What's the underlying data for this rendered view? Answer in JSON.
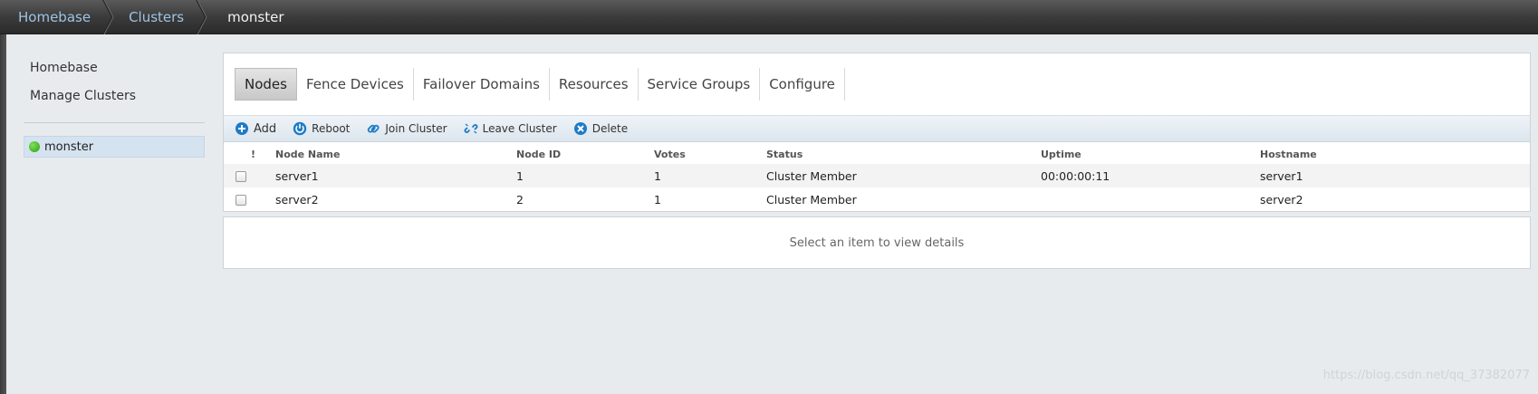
{
  "breadcrumb": {
    "items": [
      "Homebase",
      "Clusters"
    ],
    "current": "monster"
  },
  "sidebar": {
    "links": [
      "Homebase",
      "Manage Clusters"
    ],
    "clusters": [
      {
        "name": "monster",
        "status": "running",
        "status_color": "#3aad17"
      }
    ]
  },
  "tabs": [
    {
      "label": "Nodes",
      "active": true
    },
    {
      "label": "Fence Devices"
    },
    {
      "label": "Failover Domains"
    },
    {
      "label": "Resources"
    },
    {
      "label": "Service Groups"
    },
    {
      "label": "Configure"
    }
  ],
  "toolbar": {
    "add": "Add",
    "reboot": "Reboot",
    "join": "Join Cluster",
    "leave": "Leave Cluster",
    "delete": "Delete"
  },
  "table": {
    "headers": {
      "flag": "!",
      "name": "Node Name",
      "id": "Node ID",
      "votes": "Votes",
      "status": "Status",
      "uptime": "Uptime",
      "hostname": "Hostname"
    },
    "rows": [
      {
        "name": "server1",
        "id": "1",
        "votes": "1",
        "status": "Cluster Member",
        "uptime": "00:00:00:11",
        "hostname": "server1"
      },
      {
        "name": "server2",
        "id": "2",
        "votes": "1",
        "status": "Cluster Member",
        "uptime": "",
        "hostname": "server2"
      }
    ]
  },
  "details": {
    "placeholder": "Select an item to view details"
  },
  "watermark": "https://blog.csdn.net/qq_37382077",
  "colors": {
    "accent": "#1e7bc6",
    "topbar": "#3b3b3b",
    "crumb_link": "#9ec4e4"
  }
}
